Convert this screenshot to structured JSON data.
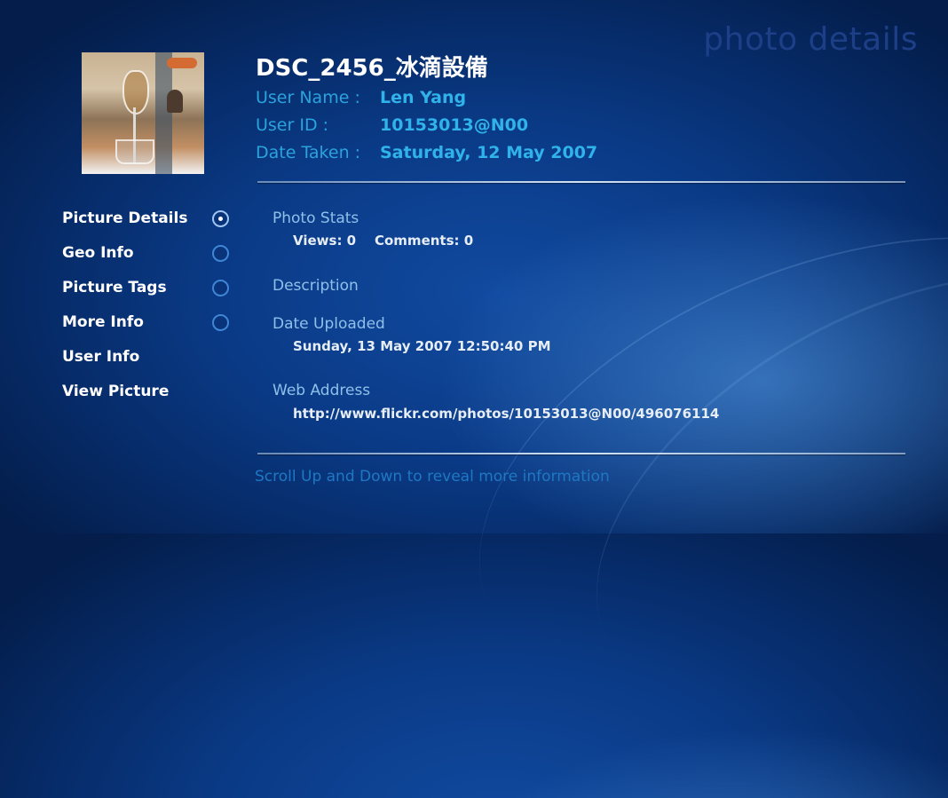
{
  "page_title": "photo details",
  "photo": {
    "title": "DSC_2456_冰滴設備",
    "user_name_label": "User Name :",
    "user_name": "Len Yang",
    "user_id_label": "User ID :",
    "user_id": "10153013@N00",
    "date_taken_label": "Date Taken :",
    "date_taken": "Saturday, 12 May 2007"
  },
  "nav": {
    "items": [
      {
        "label": "Picture Details",
        "radio": true,
        "selected": true
      },
      {
        "label": "Geo Info",
        "radio": true,
        "selected": false
      },
      {
        "label": "Picture Tags",
        "radio": true,
        "selected": false
      },
      {
        "label": "More Info",
        "radio": true,
        "selected": false
      },
      {
        "label": "User Info",
        "radio": false
      },
      {
        "label": "View Picture",
        "radio": false
      }
    ]
  },
  "details": {
    "photo_stats_label": "Photo Stats",
    "stats_text": "Views: 0    Comments: 0",
    "description_label": "Description",
    "date_uploaded_label": "Date Uploaded",
    "date_uploaded": "Sunday, 13 May 2007 12:50:40 PM",
    "web_address_label": "Web Address",
    "web_address": "http://www.flickr.com/photos/10153013@N00/496076114"
  },
  "hint": "Scroll Up and Down to reveal more information",
  "colors": {
    "accent": "#2fb3ea",
    "background": "#0a3a86",
    "title_faint": "#1d3f88"
  }
}
